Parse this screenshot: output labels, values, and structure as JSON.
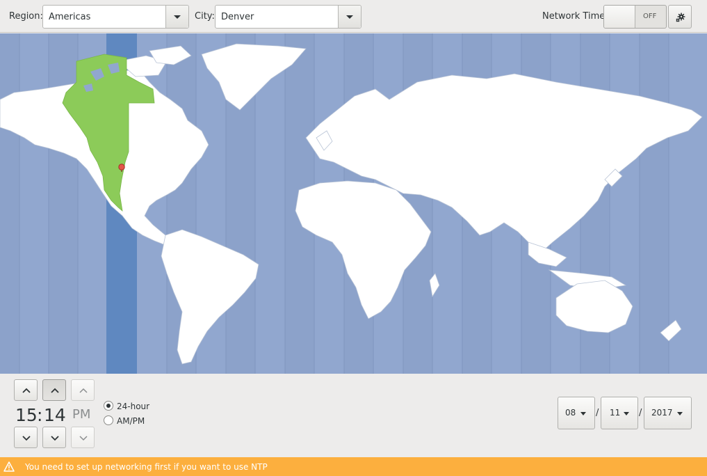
{
  "topbar": {
    "region_label": "Region:",
    "region_value": "Americas",
    "city_label": "City:",
    "city_value": "Denver",
    "network_time_label": "Network Time",
    "network_time_state": "OFF"
  },
  "time": {
    "hours": "15",
    "separator": ":",
    "minutes": "14",
    "ampm": "PM",
    "format_24h_label": "24-hour",
    "format_ampm_label": "AM/PM",
    "selected_format": "24-hour"
  },
  "date": {
    "month": "08",
    "day": "11",
    "year": "2017",
    "separator": "/"
  },
  "warning": {
    "message": "You need to set up networking first if you want to use NTP"
  },
  "colors": {
    "ocean": "#91a7cf",
    "land": "#ffffff",
    "selected_zone": "#5f88c0",
    "selected_region": "#8ccb59",
    "warning": "#fcaf3e"
  },
  "icons": {
    "network_settings": "gear-icon",
    "city_marker": "map-pin-icon",
    "warning": "warning-icon"
  }
}
